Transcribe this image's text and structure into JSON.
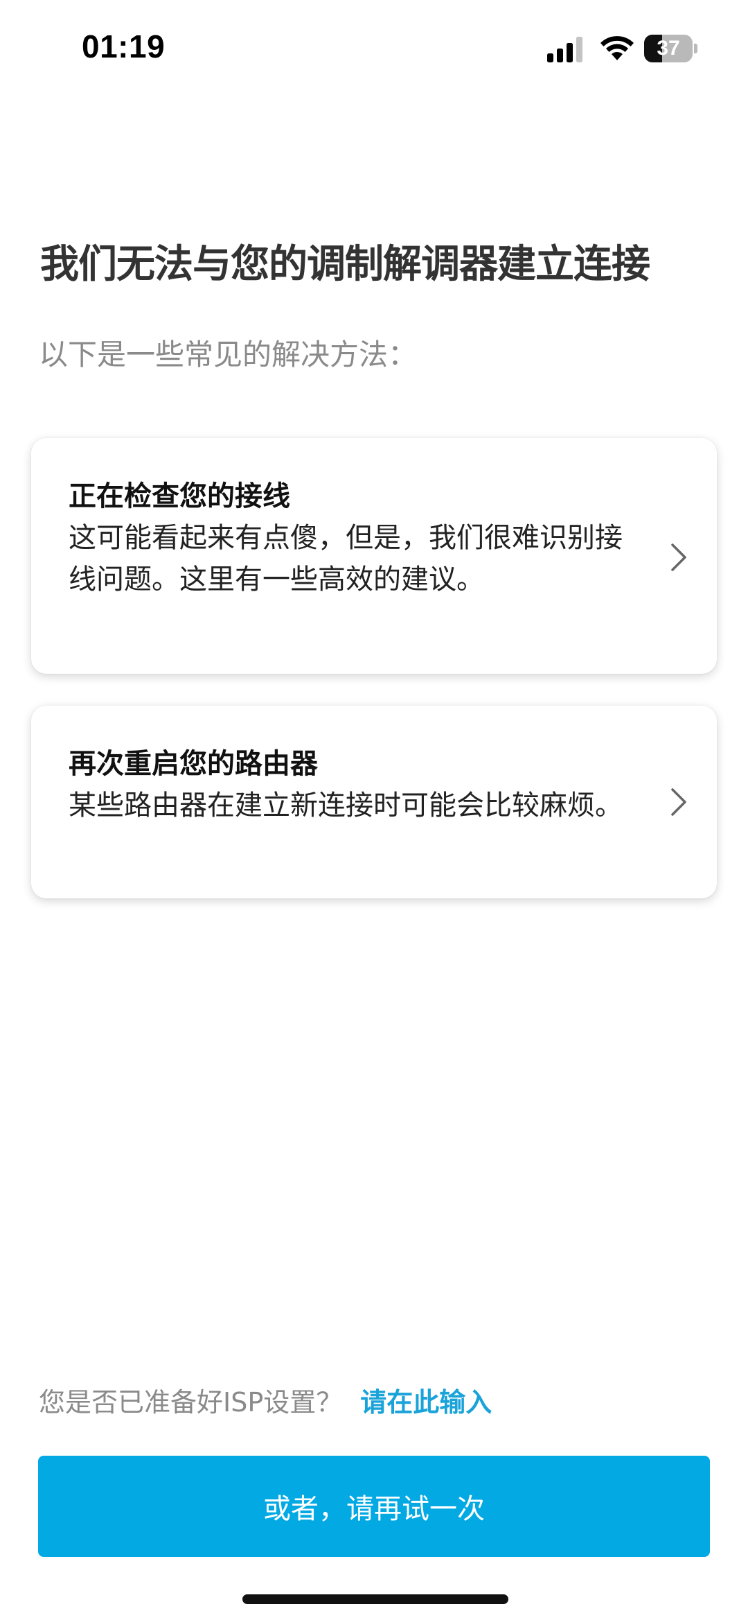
{
  "status_bar": {
    "time": "01:19",
    "battery_level": "37",
    "battery_fraction": 0.37
  },
  "header": {
    "title": "我们无法与您的调制解调器建立连接",
    "subtitle": "以下是一些常见的解决方法："
  },
  "cards": [
    {
      "title": "正在检查您的接线",
      "description": "这可能看起来有点傻，但是，我们很难识别接线问题。这里有一些高效的建议。",
      "icon": "chevron-right-icon"
    },
    {
      "title": "再次重启您的路由器",
      "description": "某些路由器在建立新连接时可能会比较麻烦。",
      "icon": "chevron-right-icon"
    }
  ],
  "footer": {
    "isp_question": "您是否已准备好ISP设置？",
    "isp_link": "请在此输入",
    "retry_button": "或者，请再试一次"
  },
  "colors": {
    "accent": "#03a9e3",
    "link": "#1aa3d9",
    "muted_text": "#8a8a8a"
  }
}
